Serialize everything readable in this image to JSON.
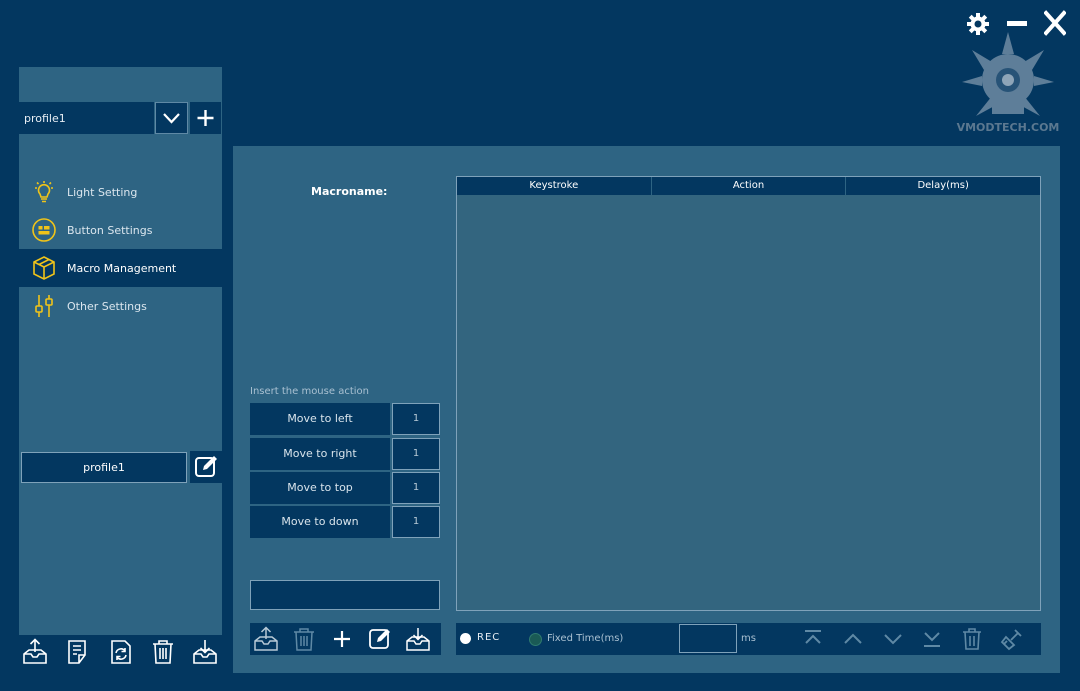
{
  "window": {
    "controls": [
      "gear-icon",
      "minimize-icon",
      "close-icon"
    ],
    "watermark_text": "VMODTECH.COM"
  },
  "sidebar": {
    "profile_select": "profile1",
    "items": [
      {
        "label": "Light Setting",
        "icon": "lightbulb-icon",
        "active": false
      },
      {
        "label": "Button Settings",
        "icon": "button-grid-icon",
        "active": false
      },
      {
        "label": "Macro Management",
        "icon": "cube-icon",
        "active": true
      },
      {
        "label": "Other Settings",
        "icon": "sliders-icon",
        "active": false
      }
    ],
    "profile_name": "profile1",
    "bottom_icons": [
      "export-icon",
      "notes-icon",
      "refresh-icon",
      "trash-icon",
      "import-icon"
    ]
  },
  "macro": {
    "name_label": "Macroname:",
    "insert_label": "Insert the mouse action",
    "moves": [
      {
        "label": "Move to left",
        "value": "1"
      },
      {
        "label": "Move to right",
        "value": "1"
      },
      {
        "label": "Move to top",
        "value": "1"
      },
      {
        "label": "Move to down",
        "value": "1"
      }
    ],
    "toolbar_icons": [
      "export-icon",
      "trash-icon",
      "add-icon",
      "edit-icon",
      "import-icon"
    ]
  },
  "table": {
    "columns": [
      "Keystroke",
      "Action",
      "Delay(ms)"
    ],
    "rows": []
  },
  "record_bar": {
    "rec_label": "REC",
    "fixed_label": "Fixed Time(ms)",
    "ms_value": "",
    "ms_label": "ms",
    "icons": [
      "move-top-icon",
      "move-up-icon",
      "move-down-icon",
      "move-bottom-icon",
      "trash-icon",
      "clear-icon"
    ]
  },
  "colors": {
    "background": "#033760",
    "panel": "#2e6483",
    "accent": "#f0c419"
  }
}
